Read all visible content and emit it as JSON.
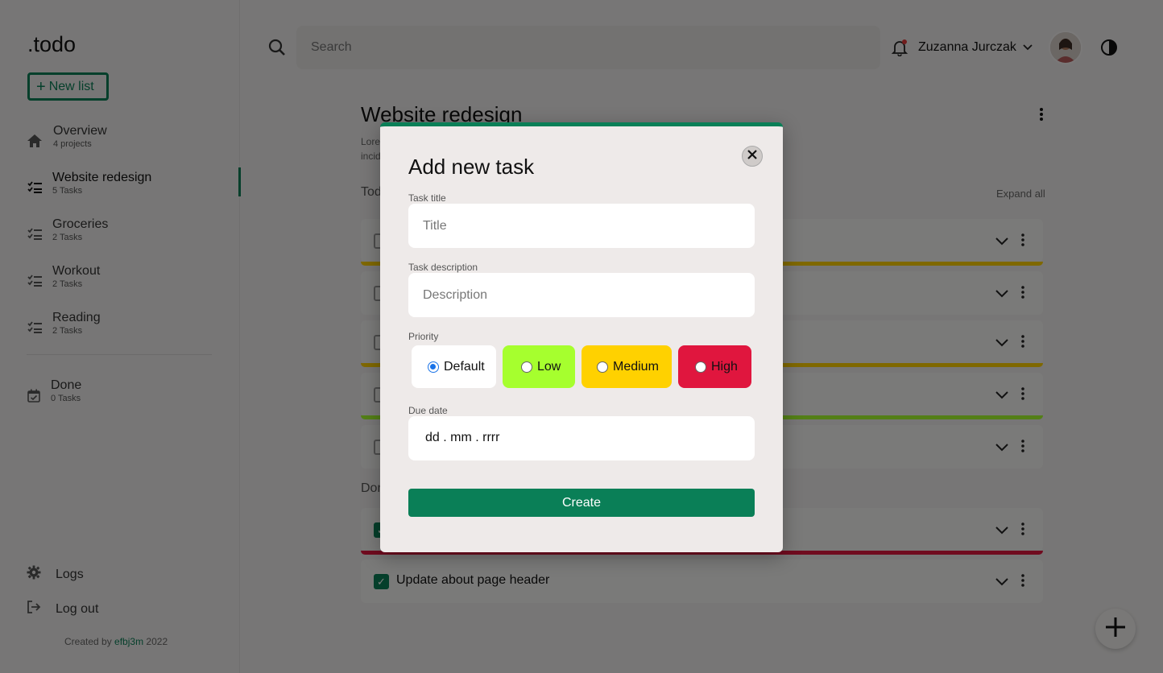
{
  "app": {
    "logo": ".todo",
    "new_list_label": "New list"
  },
  "sidebar": {
    "items": [
      {
        "name": "Overview",
        "sub": "4 projects"
      },
      {
        "name": "Website redesign",
        "sub": "5 Tasks"
      },
      {
        "name": "Groceries",
        "sub": "2 Tasks"
      },
      {
        "name": "Workout",
        "sub": "2 Tasks"
      },
      {
        "name": "Reading",
        "sub": "2 Tasks"
      }
    ],
    "done": {
      "name": "Done",
      "sub": "0 Tasks"
    },
    "logs": "Logs",
    "logout": "Log out",
    "credit_prefix": "Created by",
    "credit_link": "efbj3m",
    "credit_year": "2022"
  },
  "header": {
    "search_placeholder": "Search",
    "user_name": "Zuzanna Jurczak"
  },
  "main": {
    "title": "Website redesign",
    "desc_line1": "Lore",
    "desc_line2": "incid",
    "todo_label": "Tod",
    "expand_all": "Expand all",
    "done_label": "Don",
    "done_task_title": "Update about page header"
  },
  "colors": {
    "accent": "#0a7f57",
    "low": "#a6ff2e",
    "medium": "#ffd100",
    "high": "#e0163e",
    "bar_yellow": "#c9b200",
    "bar_green": "#7fb000",
    "bar_red": "#b4102e"
  },
  "modal": {
    "title": "Add new task",
    "task_title_label": "Task title",
    "task_title_placeholder": "Title",
    "task_desc_label": "Task description",
    "task_desc_placeholder": "Description",
    "priority_label": "Priority",
    "priorities": [
      "Default",
      "Low",
      "Medium",
      "High"
    ],
    "selected_priority": "Default",
    "due_label": "Due date",
    "due_value": "dd . mm . rrrr",
    "create_label": "Create"
  }
}
